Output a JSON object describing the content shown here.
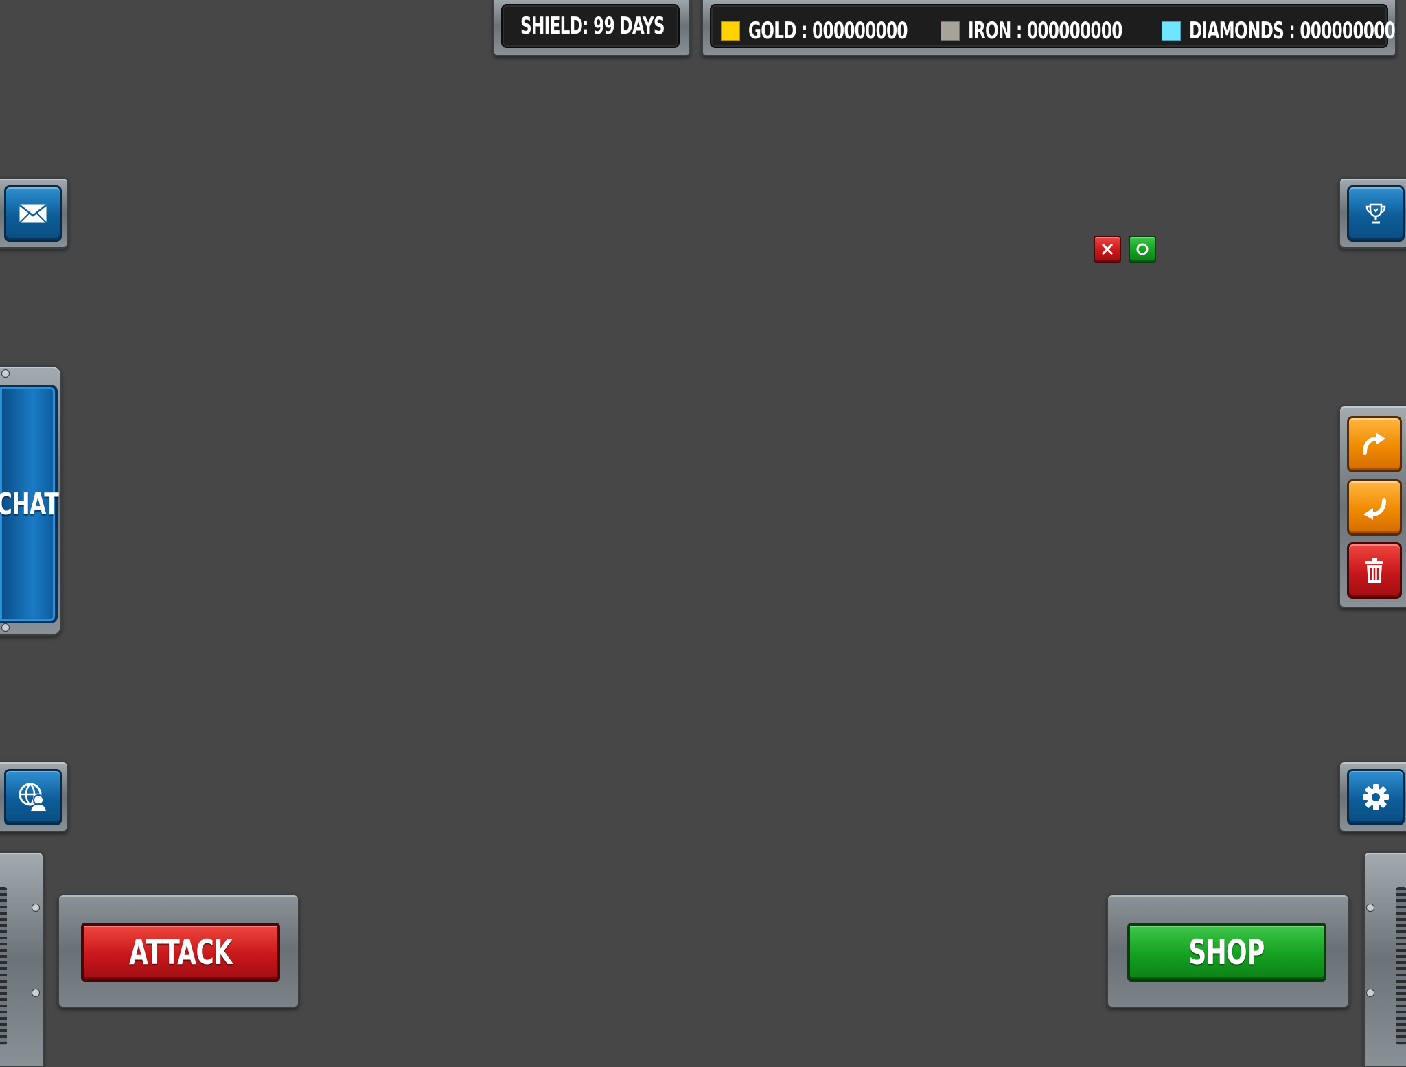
{
  "hud": {
    "shield": {
      "label": "SHIELD: 99 DAYS",
      "icon": "shield-icon"
    },
    "resources": [
      {
        "name": "gold",
        "label": "GOLD : 000000000",
        "color": "#ffd200"
      },
      {
        "name": "iron",
        "label": "IRON : 000000000",
        "color": "#a7a39a"
      },
      {
        "name": "diamonds",
        "label": "DIAMONDS : 000000000",
        "color": "#6ee6ff"
      }
    ]
  },
  "left_buttons": {
    "mail": {
      "icon": "mail-icon"
    },
    "chat": {
      "label": "CHAT"
    },
    "world": {
      "icon": "globe-user-icon"
    }
  },
  "right_buttons": {
    "trophy": {
      "icon": "trophy-icon"
    },
    "redo": {
      "icon": "redo-icon"
    },
    "undo": {
      "icon": "undo-icon"
    },
    "delete": {
      "icon": "trash-icon"
    },
    "settings": {
      "icon": "gear-icon"
    }
  },
  "placement": {
    "cancel_icon": "close-icon",
    "confirm_icon": "confirm-circle-icon"
  },
  "actions": {
    "attack_label": "ATTACK",
    "shop_label": "SHOP"
  }
}
